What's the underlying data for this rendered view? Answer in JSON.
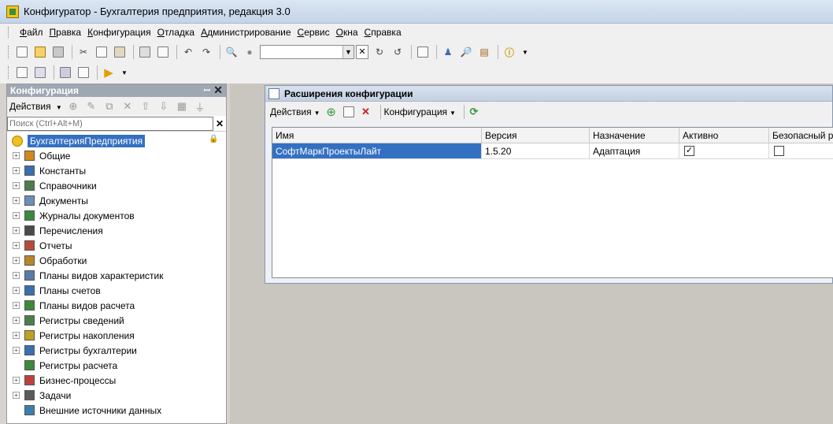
{
  "window": {
    "title": "Конфигуратор - Бухгалтерия предприятия, редакция 3.0"
  },
  "menu": [
    "Файл",
    "Правка",
    "Конфигурация",
    "Отладка",
    "Администрирование",
    "Сервис",
    "Окна",
    "Справка"
  ],
  "toolbar": {
    "search_value": ""
  },
  "left_panel": {
    "title": "Конфигурация",
    "actions_label": "Действия",
    "search_placeholder": "Поиск (Ctrl+Alt+M)",
    "root": "БухгалтерияПредприятия",
    "items": [
      {
        "label": "Общие",
        "icon": "common-icon",
        "color": "#d08a1a"
      },
      {
        "label": "Константы",
        "icon": "constants-icon",
        "color": "#3a6fb0"
      },
      {
        "label": "Справочники",
        "icon": "catalogs-icon",
        "color": "#4a7f4a"
      },
      {
        "label": "Документы",
        "icon": "documents-icon",
        "color": "#6a8fb8"
      },
      {
        "label": "Журналы документов",
        "icon": "journals-icon",
        "color": "#3c8a3c"
      },
      {
        "label": "Перечисления",
        "icon": "enums-icon",
        "color": "#4a4a4a"
      },
      {
        "label": "Отчеты",
        "icon": "reports-icon",
        "color": "#b84a3a"
      },
      {
        "label": "Обработки",
        "icon": "processing-icon",
        "color": "#b8862a"
      },
      {
        "label": "Планы видов характеристик",
        "icon": "characteristics-icon",
        "color": "#5a7aa8"
      },
      {
        "label": "Планы счетов",
        "icon": "chart-of-accounts-icon",
        "color": "#3a6fb0"
      },
      {
        "label": "Планы видов расчета",
        "icon": "calc-types-icon",
        "color": "#3c8a3c"
      },
      {
        "label": "Регистры сведений",
        "icon": "info-registers-icon",
        "color": "#4a7f4a"
      },
      {
        "label": "Регистры накопления",
        "icon": "accum-registers-icon",
        "color": "#c0a020"
      },
      {
        "label": "Регистры бухгалтерии",
        "icon": "accounting-registers-icon",
        "color": "#3a6fb0"
      },
      {
        "label": "Регистры расчета",
        "icon": "calc-registers-icon",
        "color": "#3c8a3c",
        "no_expander": true
      },
      {
        "label": "Бизнес-процессы",
        "icon": "business-processes-icon",
        "color": "#c04040"
      },
      {
        "label": "Задачи",
        "icon": "tasks-icon",
        "color": "#5a5a5a"
      },
      {
        "label": "Внешние источники данных",
        "icon": "external-sources-icon",
        "color": "#3a7fb0",
        "no_expander": true
      }
    ]
  },
  "extensions_window": {
    "title": "Расширения конфигурации",
    "actions_label": "Действия",
    "config_label": "Конфигурация",
    "columns": [
      "Имя",
      "Версия",
      "Назначение",
      "Активно",
      "Безопасный ре"
    ],
    "rows": [
      {
        "name": "СофтМаркПроектыЛайт",
        "version": "1.5.20",
        "purpose": "Адаптация",
        "active": true,
        "safe_mode": false
      }
    ]
  },
  "colors": {
    "selection": "#3470c2",
    "panel_header": "#9fa7b3"
  }
}
